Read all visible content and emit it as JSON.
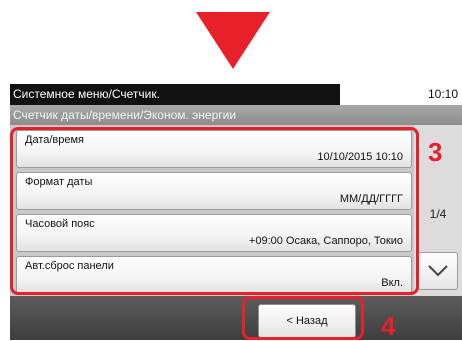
{
  "header": {
    "title": "Системное меню/Счетчик.",
    "time": "10:10",
    "subtitle": "Счетчик даты/времени/Эконом. энергии"
  },
  "settings": [
    {
      "label": "Дата/время",
      "value": "10/10/2015 10:10"
    },
    {
      "label": "Формат даты",
      "value": "ММ/ДД/ГГГГ"
    },
    {
      "label": "Часовой пояс",
      "value": "+09:00 Осака, Саппоро, Токио"
    },
    {
      "label": "Авт.сброс панели",
      "value": "Вкл."
    }
  ],
  "pagination": {
    "page": "1/4"
  },
  "footer": {
    "back_label": "< Назад"
  },
  "annotations": {
    "step3": "3",
    "step4": "4"
  },
  "icons": {
    "down": "chevron-down-icon",
    "pointer": "down-arrow-indicator"
  },
  "colors": {
    "accent": "#e8202a",
    "titlebar": "#111111",
    "footer": "#4a4a4a"
  }
}
